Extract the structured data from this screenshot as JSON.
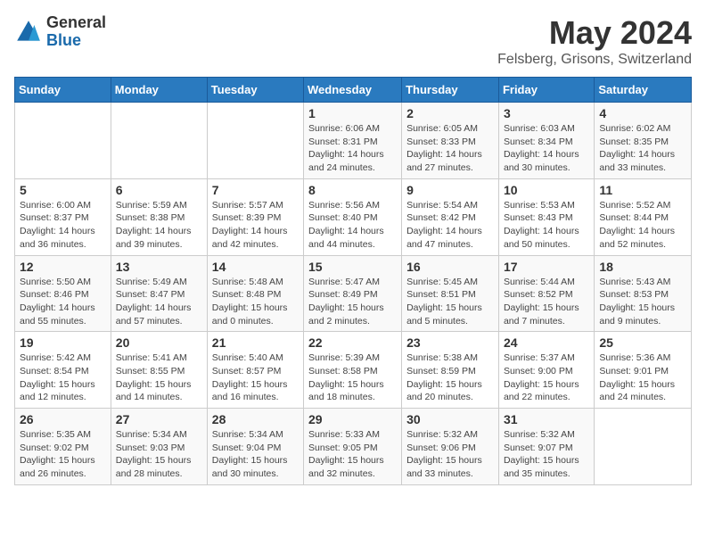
{
  "logo": {
    "general": "General",
    "blue": "Blue"
  },
  "title": "May 2024",
  "subtitle": "Felsberg, Grisons, Switzerland",
  "days_header": [
    "Sunday",
    "Monday",
    "Tuesday",
    "Wednesday",
    "Thursday",
    "Friday",
    "Saturday"
  ],
  "weeks": [
    [
      {
        "day": "",
        "info": ""
      },
      {
        "day": "",
        "info": ""
      },
      {
        "day": "",
        "info": ""
      },
      {
        "day": "1",
        "info": "Sunrise: 6:06 AM\nSunset: 8:31 PM\nDaylight: 14 hours and 24 minutes."
      },
      {
        "day": "2",
        "info": "Sunrise: 6:05 AM\nSunset: 8:33 PM\nDaylight: 14 hours and 27 minutes."
      },
      {
        "day": "3",
        "info": "Sunrise: 6:03 AM\nSunset: 8:34 PM\nDaylight: 14 hours and 30 minutes."
      },
      {
        "day": "4",
        "info": "Sunrise: 6:02 AM\nSunset: 8:35 PM\nDaylight: 14 hours and 33 minutes."
      }
    ],
    [
      {
        "day": "5",
        "info": "Sunrise: 6:00 AM\nSunset: 8:37 PM\nDaylight: 14 hours and 36 minutes."
      },
      {
        "day": "6",
        "info": "Sunrise: 5:59 AM\nSunset: 8:38 PM\nDaylight: 14 hours and 39 minutes."
      },
      {
        "day": "7",
        "info": "Sunrise: 5:57 AM\nSunset: 8:39 PM\nDaylight: 14 hours and 42 minutes."
      },
      {
        "day": "8",
        "info": "Sunrise: 5:56 AM\nSunset: 8:40 PM\nDaylight: 14 hours and 44 minutes."
      },
      {
        "day": "9",
        "info": "Sunrise: 5:54 AM\nSunset: 8:42 PM\nDaylight: 14 hours and 47 minutes."
      },
      {
        "day": "10",
        "info": "Sunrise: 5:53 AM\nSunset: 8:43 PM\nDaylight: 14 hours and 50 minutes."
      },
      {
        "day": "11",
        "info": "Sunrise: 5:52 AM\nSunset: 8:44 PM\nDaylight: 14 hours and 52 minutes."
      }
    ],
    [
      {
        "day": "12",
        "info": "Sunrise: 5:50 AM\nSunset: 8:46 PM\nDaylight: 14 hours and 55 minutes."
      },
      {
        "day": "13",
        "info": "Sunrise: 5:49 AM\nSunset: 8:47 PM\nDaylight: 14 hours and 57 minutes."
      },
      {
        "day": "14",
        "info": "Sunrise: 5:48 AM\nSunset: 8:48 PM\nDaylight: 15 hours and 0 minutes."
      },
      {
        "day": "15",
        "info": "Sunrise: 5:47 AM\nSunset: 8:49 PM\nDaylight: 15 hours and 2 minutes."
      },
      {
        "day": "16",
        "info": "Sunrise: 5:45 AM\nSunset: 8:51 PM\nDaylight: 15 hours and 5 minutes."
      },
      {
        "day": "17",
        "info": "Sunrise: 5:44 AM\nSunset: 8:52 PM\nDaylight: 15 hours and 7 minutes."
      },
      {
        "day": "18",
        "info": "Sunrise: 5:43 AM\nSunset: 8:53 PM\nDaylight: 15 hours and 9 minutes."
      }
    ],
    [
      {
        "day": "19",
        "info": "Sunrise: 5:42 AM\nSunset: 8:54 PM\nDaylight: 15 hours and 12 minutes."
      },
      {
        "day": "20",
        "info": "Sunrise: 5:41 AM\nSunset: 8:55 PM\nDaylight: 15 hours and 14 minutes."
      },
      {
        "day": "21",
        "info": "Sunrise: 5:40 AM\nSunset: 8:57 PM\nDaylight: 15 hours and 16 minutes."
      },
      {
        "day": "22",
        "info": "Sunrise: 5:39 AM\nSunset: 8:58 PM\nDaylight: 15 hours and 18 minutes."
      },
      {
        "day": "23",
        "info": "Sunrise: 5:38 AM\nSunset: 8:59 PM\nDaylight: 15 hours and 20 minutes."
      },
      {
        "day": "24",
        "info": "Sunrise: 5:37 AM\nSunset: 9:00 PM\nDaylight: 15 hours and 22 minutes."
      },
      {
        "day": "25",
        "info": "Sunrise: 5:36 AM\nSunset: 9:01 PM\nDaylight: 15 hours and 24 minutes."
      }
    ],
    [
      {
        "day": "26",
        "info": "Sunrise: 5:35 AM\nSunset: 9:02 PM\nDaylight: 15 hours and 26 minutes."
      },
      {
        "day": "27",
        "info": "Sunrise: 5:34 AM\nSunset: 9:03 PM\nDaylight: 15 hours and 28 minutes."
      },
      {
        "day": "28",
        "info": "Sunrise: 5:34 AM\nSunset: 9:04 PM\nDaylight: 15 hours and 30 minutes."
      },
      {
        "day": "29",
        "info": "Sunrise: 5:33 AM\nSunset: 9:05 PM\nDaylight: 15 hours and 32 minutes."
      },
      {
        "day": "30",
        "info": "Sunrise: 5:32 AM\nSunset: 9:06 PM\nDaylight: 15 hours and 33 minutes."
      },
      {
        "day": "31",
        "info": "Sunrise: 5:32 AM\nSunset: 9:07 PM\nDaylight: 15 hours and 35 minutes."
      },
      {
        "day": "",
        "info": ""
      }
    ]
  ]
}
